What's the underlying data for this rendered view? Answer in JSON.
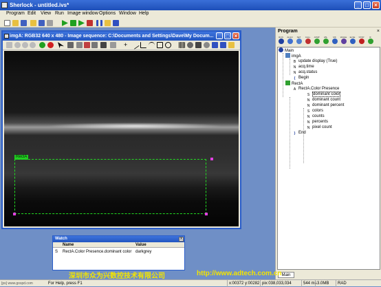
{
  "app": {
    "title": "Sherlock - untitled.ivs*"
  },
  "menu": [
    "Program",
    "Edit",
    "View",
    "Run",
    "Image window",
    "Options",
    "Window",
    "Help"
  ],
  "image_window": {
    "title": "imgA: RGB32 640 x 480 - Image sequence: C:\\Documents and Settings\\Dave\\My Docum..."
  },
  "roi": {
    "label": "RectA"
  },
  "watch": {
    "title": "Watch",
    "columns": [
      "Name",
      "Value"
    ],
    "rows": [
      {
        "type": "S",
        "name": "RectA.Color Presence.dominant color",
        "value": "darkgrey"
      }
    ]
  },
  "program_panel": {
    "title": "Program",
    "toolbar_labels": [
      "RUN",
      "ALGO",
      "SET",
      "CALL",
      "JUMP",
      "LBL",
      "MK",
      "WHILE",
      "ELSE",
      "STOP",
      "IF"
    ],
    "tree": [
      {
        "text": "Main",
        "icon": "main-icon",
        "level": 0
      },
      {
        "text": "imgA",
        "icon": "image-icon",
        "level": 1
      },
      {
        "text": "update display (True)",
        "icon": "bool-icon",
        "level": 2
      },
      {
        "text": "acq.time",
        "icon": "number-icon",
        "level": 2
      },
      {
        "text": "acq.status",
        "icon": "number-icon",
        "level": 2
      },
      {
        "text": "Begin",
        "icon": "bracket-icon",
        "level": 2
      },
      {
        "text": "RectA",
        "icon": "roi-icon",
        "level": 1
      },
      {
        "text": "RectA.Color Presence",
        "icon": "algorithm-icon",
        "level": 2
      },
      {
        "text": "dominant color",
        "icon": "string-icon",
        "level": 3,
        "selected": true
      },
      {
        "text": "dominant count",
        "icon": "number-icon",
        "level": 3
      },
      {
        "text": "dominant percent",
        "icon": "number-icon",
        "level": 3
      },
      {
        "text": "colors",
        "icon": "string-array-icon",
        "level": 3
      },
      {
        "text": "counts",
        "icon": "number-array-icon",
        "level": 3
      },
      {
        "text": "percents",
        "icon": "number-array-icon",
        "level": 3
      },
      {
        "text": "pixel count",
        "icon": "number-icon",
        "level": 3
      },
      {
        "text": "End",
        "icon": "bracket-icon",
        "level": 2
      }
    ],
    "tab": "Main"
  },
  "status": {
    "help": "For Help, press F1",
    "coords": "x:00372 y:00282",
    "pixel": "pix:038,033,034",
    "time": "544 ms",
    "memory": "3.0MB",
    "mode": "RAD"
  },
  "watermarks": {
    "left": "[ps] www.gospd.com",
    "center": "深圳市众为兴数控技术有限公司",
    "right": "http://www.adtech.com.cn"
  },
  "colors": {
    "titlebar": "#2255c0",
    "roi": "#22dd22",
    "handle": "#e040e0",
    "watermark": "#f3e400"
  }
}
